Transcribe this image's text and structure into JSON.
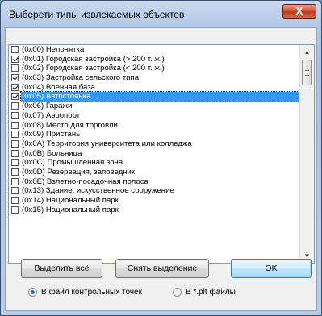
{
  "dialog": {
    "title": "Выберети типы извлекаемых объектов",
    "close_glyph": "X"
  },
  "items": [
    {
      "label": "(0x00) Непонятка",
      "checked": false,
      "selected": false
    },
    {
      "label": "(0x01) Городская застройка (> 200 т. ж.)",
      "checked": true,
      "selected": false
    },
    {
      "label": "(0x02) Городская застройка (< 200 т. ж.)",
      "checked": false,
      "selected": false
    },
    {
      "label": "(0x03) Застройка сельского типа",
      "checked": true,
      "selected": false
    },
    {
      "label": "(0x04) Военная база",
      "checked": true,
      "selected": false
    },
    {
      "label": "(0x05) Автостоянка",
      "checked": true,
      "selected": true
    },
    {
      "label": "(0x06) Гаражи",
      "checked": false,
      "selected": false
    },
    {
      "label": "(0x07) Аэропорт",
      "checked": false,
      "selected": false
    },
    {
      "label": "(0x08) Место для торговли",
      "checked": false,
      "selected": false
    },
    {
      "label": "(0x09) Пристань",
      "checked": false,
      "selected": false
    },
    {
      "label": "(0x0A) Территория университета или колледжа",
      "checked": false,
      "selected": false
    },
    {
      "label": "(0x0B) Больница",
      "checked": false,
      "selected": false
    },
    {
      "label": "(0x0C) Промышленная зона",
      "checked": false,
      "selected": false
    },
    {
      "label": "(0x0D) Резервация, заповедник",
      "checked": false,
      "selected": false
    },
    {
      "label": "(0x0E) Взлетно-посадочная полоса",
      "checked": false,
      "selected": false
    },
    {
      "label": "(0x13) Здание, искусственное сооружение",
      "checked": false,
      "selected": false
    },
    {
      "label": "(0x14) Национальный парк",
      "checked": false,
      "selected": false
    },
    {
      "label": "(0x15) Национальный парк",
      "checked": false,
      "selected": false
    }
  ],
  "scrollbar": {
    "up_glyph": "▲",
    "down_glyph": "▼"
  },
  "buttons": {
    "select_all": "Выделить всё",
    "deselect": "Снять выделение",
    "ok": "OK"
  },
  "radios": [
    {
      "label": "В файл контрольных точек",
      "checked": true
    },
    {
      "label": "В *.plt файлы",
      "checked": false
    }
  ],
  "colors": {
    "selection": "#3399ff",
    "title_bar": "#b9cfeb",
    "close_button": "#c8452a"
  }
}
